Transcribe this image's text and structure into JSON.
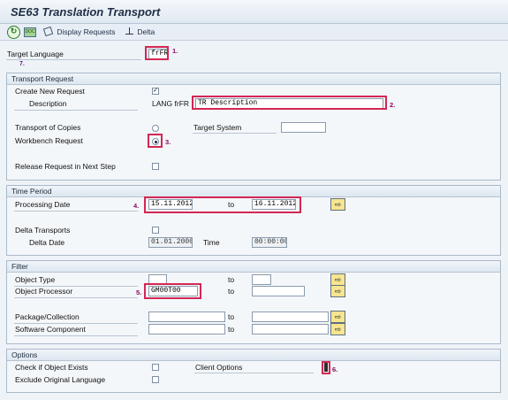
{
  "title": "SE63 Translation Transport",
  "toolbar": {
    "display_requests": "Display Requests",
    "delta": "Delta",
    "icon_run": "execute-icon",
    "icon_small": "doc-icon"
  },
  "target_language": {
    "label": "Target Language",
    "value": "frFR"
  },
  "transport_request": {
    "header": "Transport Request",
    "create_new_request": "Create New Request",
    "description": "Description",
    "lang_prefix": "LANG frFR",
    "description_value": "TR Description",
    "transport_of_copies": "Transport of Copies",
    "target_system": "Target System",
    "target_system_value": "",
    "workbench_request": "Workbench Request",
    "release_request": "Release Request in Next Step"
  },
  "time_period": {
    "header": "Time Period",
    "processing_date": "Processing Date",
    "from": "15.11.2012",
    "to_label": "to",
    "to": "16.11.2012",
    "delta_transports": "Delta Transports",
    "delta_date": "Delta Date",
    "delta_date_value": "01.01.2000",
    "time": "Time",
    "time_value": "00:00:00"
  },
  "filter": {
    "header": "Filter",
    "object_type": "Object Type",
    "object_type_value": "",
    "object_processor": "Object Processor",
    "object_processor_value": "GM00T00",
    "package_collection": "Package/Collection",
    "software_component": "Software Component",
    "to_label": "to"
  },
  "options": {
    "header": "Options",
    "check_if_object_exists": "Check if Object Exists",
    "exclude_original_language": "Exclude Original Language",
    "client_options": "Client Options"
  },
  "markers": {
    "m1": "1.",
    "m2": "2.",
    "m3": "3.",
    "m4": "4.",
    "m5": "5.",
    "m6": "6.",
    "m7": "7."
  },
  "colors": {
    "highlight": "#d32754",
    "marker": "#8a0a5d"
  }
}
